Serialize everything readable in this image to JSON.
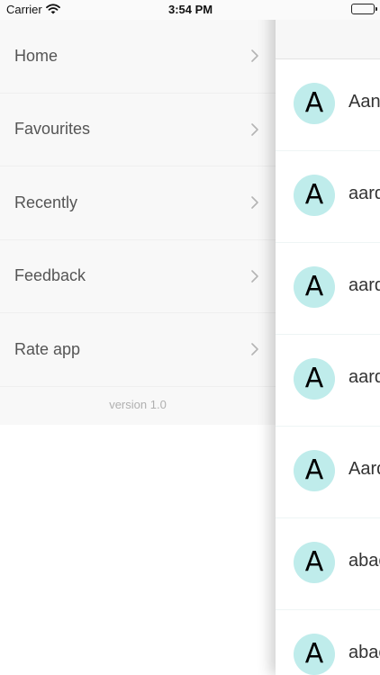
{
  "status_bar": {
    "carrier": "Carrier",
    "time": "3:54 PM",
    "wifi_icon": "wifi-icon",
    "battery_icon": "battery-icon"
  },
  "menu": {
    "items": [
      {
        "label": "Home",
        "icon": "chevron-right-icon"
      },
      {
        "label": "Favourites",
        "icon": "chevron-right-icon"
      },
      {
        "label": "Recently",
        "icon": "chevron-right-icon"
      },
      {
        "label": "Feedback",
        "icon": "chevron-right-icon"
      },
      {
        "label": "Rate app",
        "icon": "chevron-right-icon"
      }
    ],
    "version": "version 1.0"
  },
  "word_list": {
    "items": [
      {
        "initial": "A",
        "text": "Aan"
      },
      {
        "initial": "A",
        "text": "aard"
      },
      {
        "initial": "A",
        "text": "aard"
      },
      {
        "initial": "A",
        "text": "aard"
      },
      {
        "initial": "A",
        "text": "Aard"
      },
      {
        "initial": "A",
        "text": "abac"
      },
      {
        "initial": "A",
        "text": "abac"
      }
    ]
  },
  "colors": {
    "menu_background": "#f8f8f8",
    "avatar_background": "#bfeceb",
    "version_text": "#b0b0b0"
  }
}
